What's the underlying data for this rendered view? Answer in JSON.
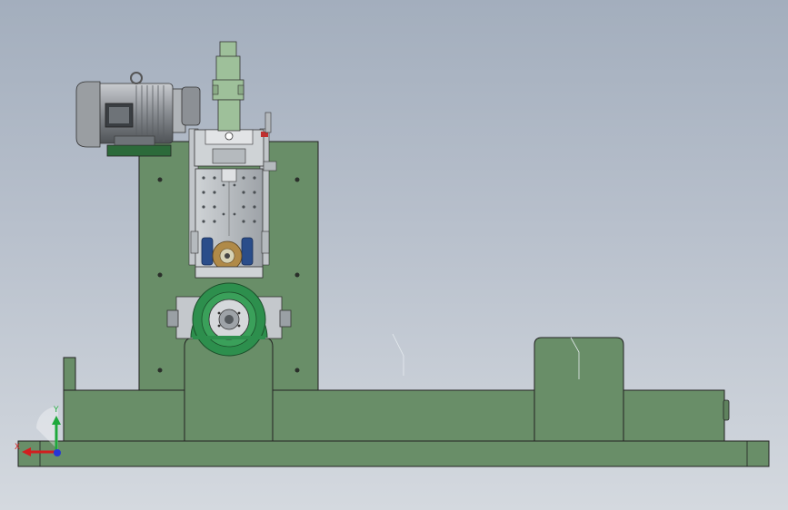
{
  "viewport": {
    "background_top": "#a3aebd",
    "background_bottom": "#d4d9df"
  },
  "colors": {
    "body_green": "#698e68",
    "body_green_light": "#7ca07a",
    "outline": "#222222",
    "steel": "#b4b9bd",
    "steel_dark": "#555a5e",
    "motor_grey": "#8d9196",
    "chuck_green": "#2d8f4d",
    "bronze": "#b08a48",
    "bearing_blue": "#2a4d8a"
  },
  "triad": {
    "x_label": "X",
    "y_label": "Y",
    "x_color": "#d11f1f",
    "y_color": "#1ea83c",
    "z_color": "#2636d6"
  },
  "icons": [
    "coordinate-triad-icon"
  ]
}
